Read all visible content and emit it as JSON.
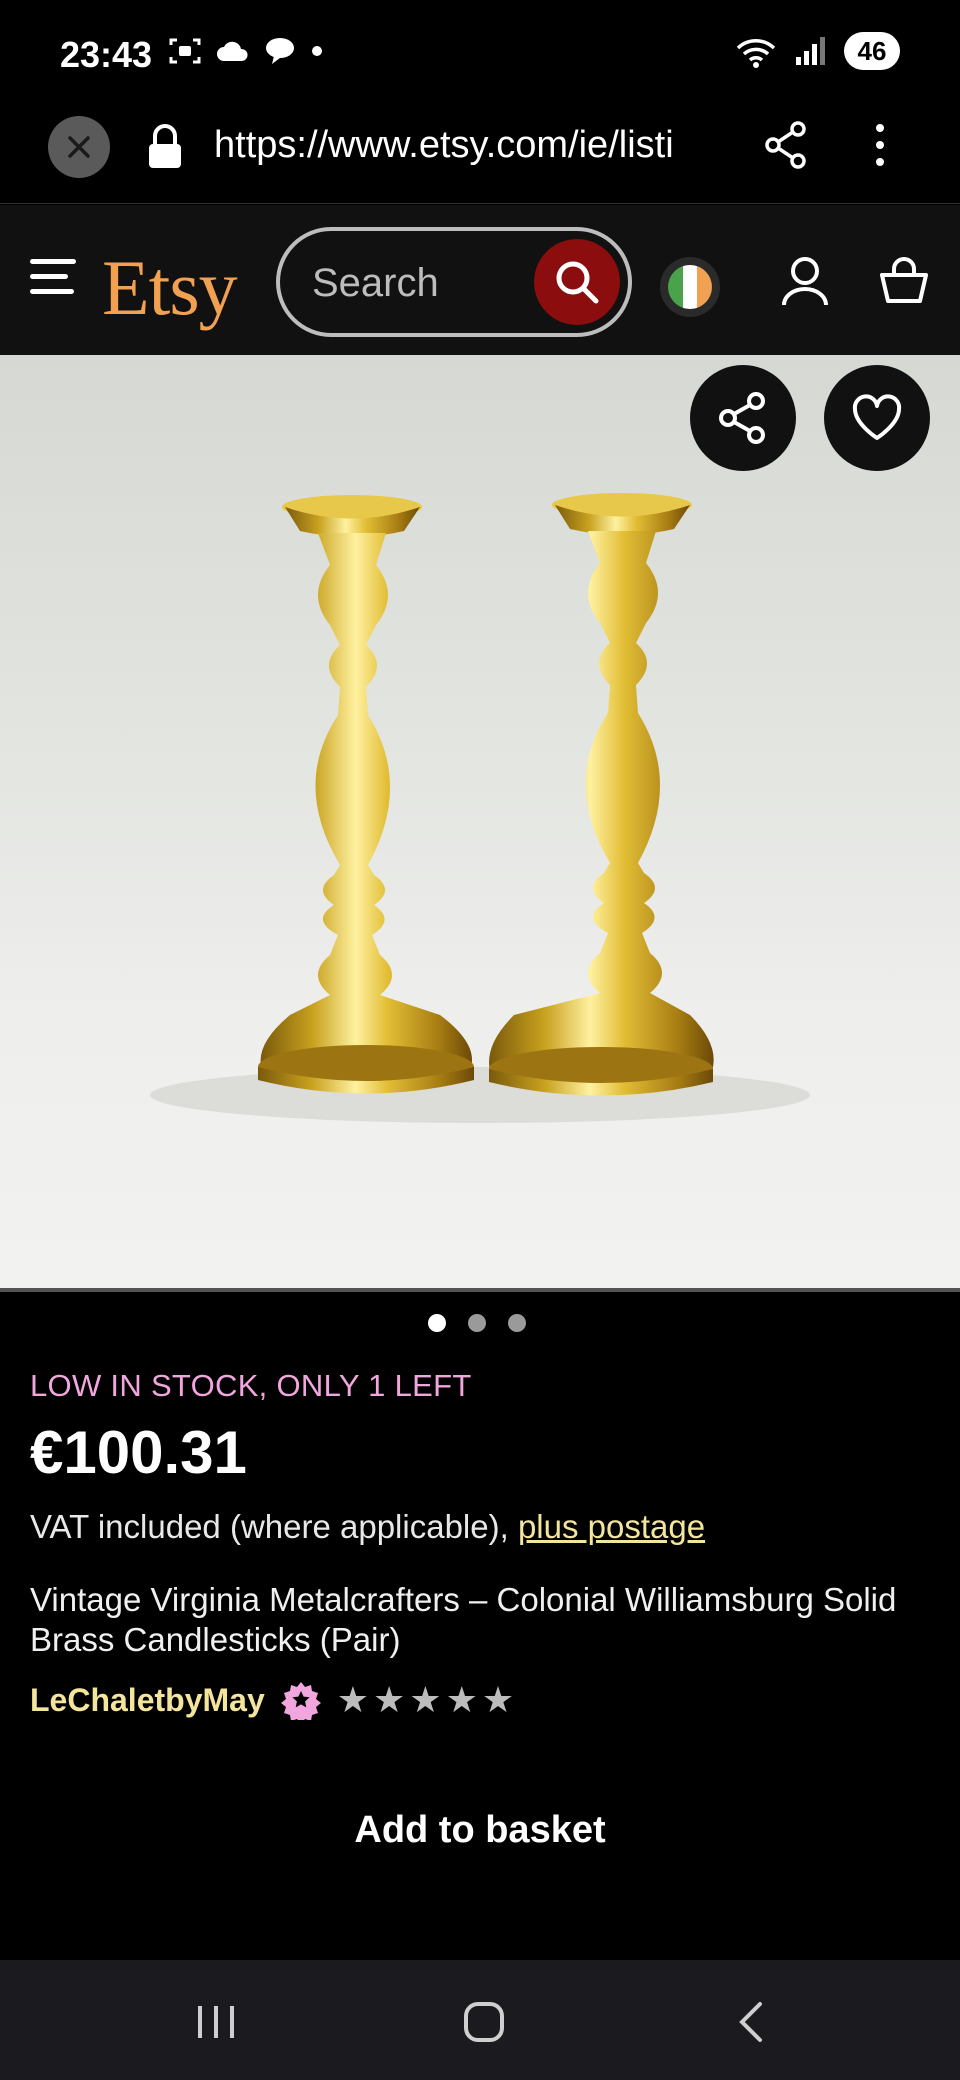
{
  "status_bar": {
    "time": "23:43",
    "battery": "46"
  },
  "browser": {
    "url": "https://www.etsy.com/ie/listi"
  },
  "header": {
    "logo": "Etsy",
    "search_placeholder": "Search",
    "brand_color": "#f1a151",
    "search_button_color": "#8b0d0d"
  },
  "product": {
    "image_count": 3,
    "active_image": 1,
    "stock_notice": "LOW IN STOCK, ONLY 1 LEFT",
    "price": "€100.31",
    "vat_text": "VAT included (where applicable),",
    "postage_link": "plus postage",
    "title": "Vintage Virginia Metalcrafters – Colonial Williamsburg Solid Brass Candlesticks (Pair)",
    "shop_name": "LeChaletbyMay",
    "rating_stars": 5,
    "add_to_basket_label": "Add to basket"
  },
  "colors": {
    "stock_color": "#f2a6de",
    "link_color": "#f4e59d"
  }
}
